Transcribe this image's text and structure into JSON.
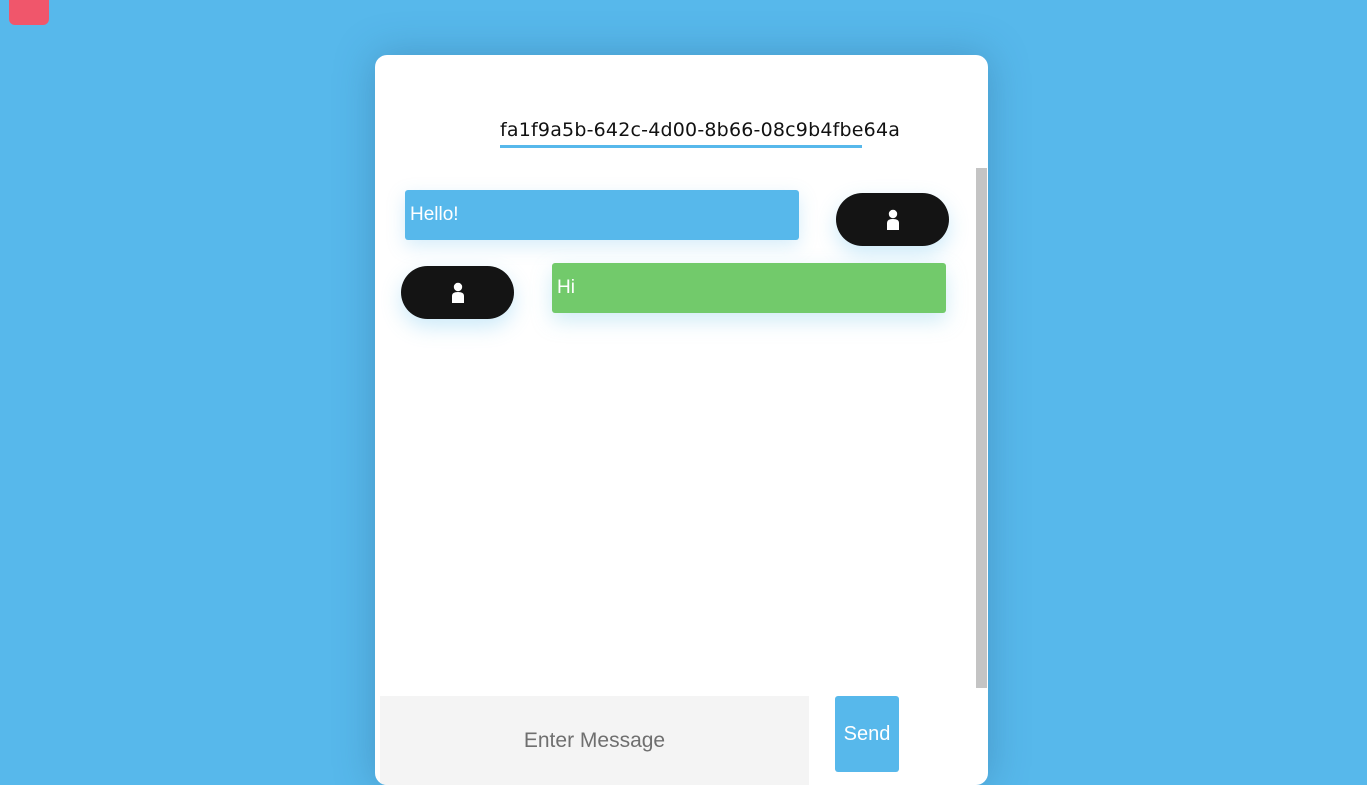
{
  "page": {
    "background_color": "#57b8eb"
  },
  "corner_button": {
    "color": "#f0566b"
  },
  "chat": {
    "room_id": "fa1f9a5b-642c-4d00-8b66-08c9b4fbe64a",
    "messages": [
      {
        "text": "Hello!",
        "side": "sent",
        "bubble_color": "#57b8eb",
        "avatar_icon": "user-icon"
      },
      {
        "text": "Hi",
        "side": "received",
        "bubble_color": "#72ca6b",
        "avatar_icon": "user-icon"
      }
    ]
  },
  "composer": {
    "placeholder": "Enter Message",
    "value": "",
    "send_label": "Send"
  }
}
